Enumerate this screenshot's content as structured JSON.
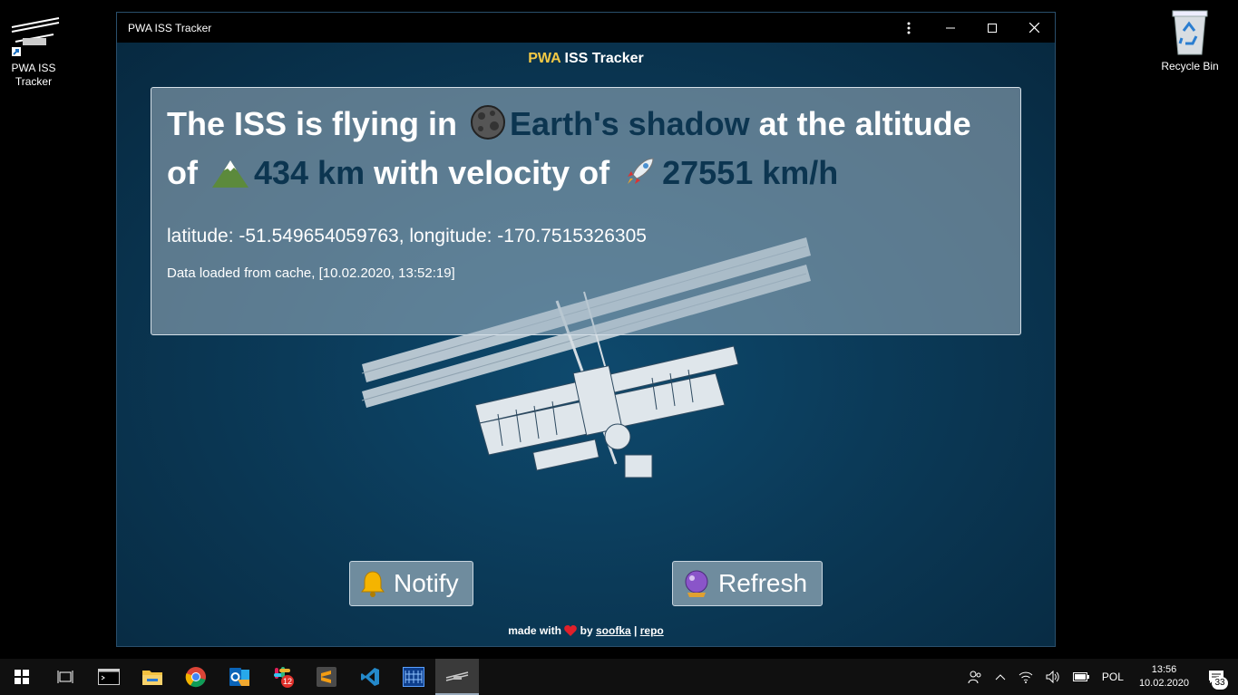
{
  "desktop": {
    "iss_icon_label": "PWA ISS Tracker",
    "recycle_bin_label": "Recycle Bin"
  },
  "window": {
    "title": "PWA ISS Tracker",
    "menu_icon": "more-vert-icon",
    "minimize_icon": "minimize-icon",
    "maximize_icon": "maximize-icon",
    "close_icon": "close-icon"
  },
  "app": {
    "header_accent": "PWA",
    "header_rest": " ISS Tracker",
    "headline": {
      "part1": "The ISS is flying in ",
      "shadow_text": "Earth's shadow",
      "part2": " at the altitude of ",
      "altitude": "434 km",
      "part3": " with velocity of ",
      "velocity": "27551 km/h"
    },
    "coords": "latitude: -51.549654059763, longitude: -170.7515326305",
    "cache_note": "Data loaded from cache, [10.02.2020, 13:52:19]",
    "notify_label": "Notify",
    "refresh_label": "Refresh",
    "footer": {
      "made_with": "made with",
      "by": "by",
      "author": "soofka",
      "separator": "|",
      "repo": "repo"
    }
  },
  "colors": {
    "accent": "#f3c945",
    "highlight": "#0c3550",
    "background": "#0b3a58"
  },
  "taskbar": {
    "items": [
      "start-icon",
      "task-view-icon",
      "terminal-icon",
      "file-explorer-icon",
      "chrome-icon",
      "outlook-icon",
      "slack-icon",
      "sublime-icon",
      "vscode-icon",
      "app-grid-icon",
      "iss-tracker-icon"
    ],
    "slack_badge": "12",
    "language": "POL",
    "time": "13:56",
    "date": "10.02.2020",
    "notification_count": "33"
  }
}
